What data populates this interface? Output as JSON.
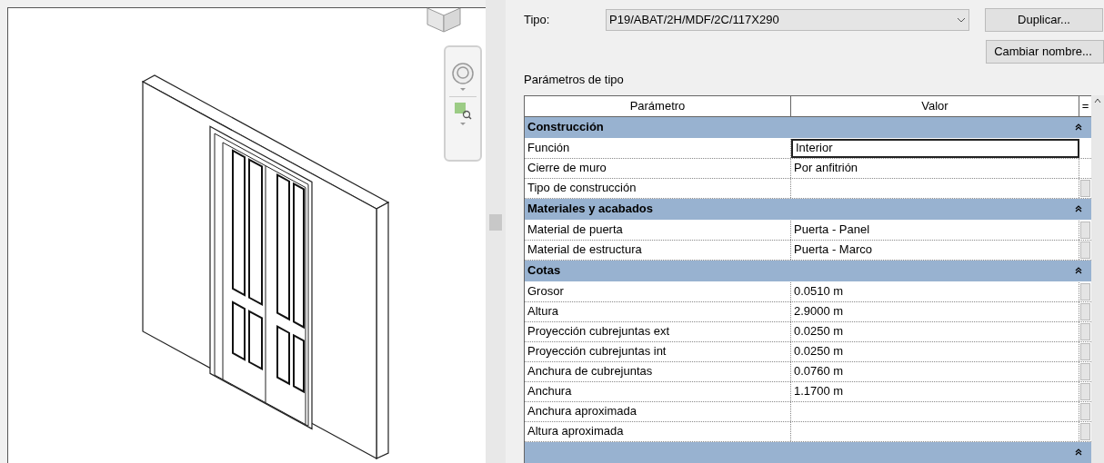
{
  "type_field": {
    "label": "Tipo:",
    "value": "P19/ABAT/2H/MDF/2C/117X290"
  },
  "buttons": [
    {
      "label": "Duplicar..."
    },
    {
      "label": "Cambiar nombre..."
    }
  ],
  "section_title": "Parámetros de tipo",
  "table": {
    "columns": [
      "Parámetro",
      "Valor",
      "="
    ],
    "groups": [
      {
        "name": "Construcción",
        "expanded": true,
        "rows": [
          {
            "parameter": "Función",
            "value": "Interior",
            "selected": true,
            "has_button": false
          },
          {
            "parameter": "Cierre de muro",
            "value": "Por anfitrión",
            "selected": false,
            "has_button": false
          },
          {
            "parameter": "Tipo de construcción",
            "selected": false,
            "has_button": true
          }
        ]
      },
      {
        "name": "Materiales y acabados",
        "expanded": true,
        "rows": [
          {
            "parameter": "Material de puerta",
            "value": "Puerta - Panel",
            "selected": false,
            "has_button": true
          },
          {
            "parameter": "Material de estructura",
            "value": "Puerta - Marco",
            "selected": false,
            "has_button": true
          }
        ]
      },
      {
        "name": "Cotas",
        "expanded": true,
        "rows": [
          {
            "parameter": "Grosor",
            "value": "0.0510 m",
            "selected": false,
            "has_button": true
          },
          {
            "parameter": "Altura",
            "value": "2.9000 m",
            "selected": false,
            "has_button": true
          },
          {
            "parameter": "Proyección cubrejuntas ext",
            "value": "0.0250 m",
            "selected": false,
            "has_button": true
          },
          {
            "parameter": "Proyección cubrejuntas int",
            "value": "0.0250 m",
            "selected": false,
            "has_button": true
          },
          {
            "parameter": "Anchura de cubrejuntas",
            "value": "0.0760 m",
            "selected": false,
            "has_button": true
          },
          {
            "parameter": "Anchura",
            "value": "1.1700 m",
            "selected": false,
            "has_button": true
          },
          {
            "parameter": "Anchura aproximada",
            "selected": false,
            "has_button": true
          },
          {
            "parameter": "Altura aproximada",
            "selected": false,
            "has_button": true
          }
        ]
      },
      {
        "expanded": true
      }
    ]
  }
}
